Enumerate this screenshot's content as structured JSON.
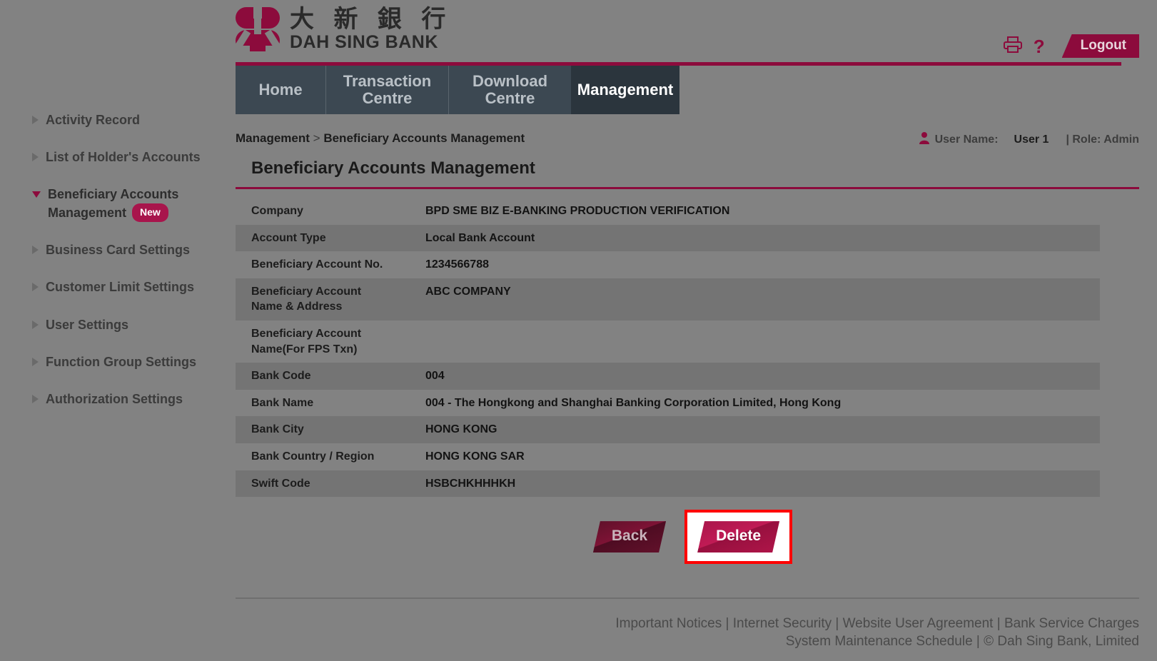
{
  "brand": {
    "name_cn": "大 新 銀 行",
    "name_en": "DAH SING BANK",
    "logo_icon": "dah-sing-logo-icon"
  },
  "header": {
    "print_icon": "print-icon",
    "help_icon": "help-question-icon",
    "logout_label": "Logout"
  },
  "nav": {
    "tabs": [
      {
        "label": "Home",
        "active": false
      },
      {
        "label": "Transaction\nCentre",
        "line1": "Transaction",
        "line2": "Centre",
        "active": false
      },
      {
        "label": "Download\nCentre",
        "line1": "Download",
        "line2": "Centre",
        "active": false
      },
      {
        "label": "Management",
        "line1": "Management",
        "line2": "",
        "active": true
      }
    ]
  },
  "breadcrumb": {
    "root": "Management",
    "separator": ">",
    "current": "Beneficiary Accounts Management"
  },
  "user": {
    "person_icon": "person-icon",
    "label": "User Name:",
    "name": "User 1",
    "role": "| Role: Admin"
  },
  "page": {
    "title": "Beneficiary Accounts Management"
  },
  "details": {
    "rows": [
      {
        "label": "Company",
        "value": "BPD SME BIZ E-BANKING PRODUCTION VERIFICATION",
        "shaded": false
      },
      {
        "label": "Account Type",
        "value": "Local Bank Account",
        "shaded": true
      },
      {
        "label": "Beneficiary Account No.",
        "value": "1234566788",
        "shaded": false
      },
      {
        "label": "Beneficiary Account Name & Address",
        "label_line1": "Beneficiary Account",
        "label_line2": "Name & Address",
        "value": "ABC COMPANY",
        "shaded": true
      },
      {
        "label": "Beneficiary Account Name(For FPS Txn)",
        "label_line1": "Beneficiary Account",
        "label_line2": "Name(For FPS Txn)",
        "value": "",
        "shaded": false
      },
      {
        "label": "Bank Code",
        "value": "004",
        "shaded": true
      },
      {
        "label": "Bank Name",
        "value": "004 - The Hongkong and Shanghai Banking Corporation Limited, Hong Kong",
        "shaded": false
      },
      {
        "label": "Bank City",
        "value": "HONG KONG",
        "shaded": true
      },
      {
        "label": "Bank Country / Region",
        "value": "HONG KONG SAR",
        "shaded": false
      },
      {
        "label": "Swift Code",
        "value": "HSBCHKHHHKH",
        "shaded": true
      }
    ]
  },
  "actions": {
    "back_label": "Back",
    "delete_label": "Delete",
    "highlight_color": "#ff0000"
  },
  "sidebar": {
    "items": [
      {
        "label": "Activity Record",
        "expanded": false,
        "badge": ""
      },
      {
        "label": "List of Holder's Accounts",
        "expanded": false,
        "badge": ""
      },
      {
        "label": "Beneficiary Accounts Management",
        "line1": "Beneficiary Accounts",
        "line2": "Management",
        "expanded": true,
        "badge": "New"
      },
      {
        "label": "Business Card Settings",
        "expanded": false,
        "badge": ""
      },
      {
        "label": "Customer Limit Settings",
        "expanded": false,
        "badge": ""
      },
      {
        "label": "User Settings",
        "expanded": false,
        "badge": ""
      },
      {
        "label": "Function Group Settings",
        "expanded": false,
        "badge": ""
      },
      {
        "label": "Authorization Settings",
        "expanded": false,
        "badge": ""
      }
    ]
  },
  "footer": {
    "line1": [
      {
        "text": "Important Notices",
        "link": true
      },
      {
        "text": " | ",
        "link": false
      },
      {
        "text": "Internet Security",
        "link": true
      },
      {
        "text": " | ",
        "link": false
      },
      {
        "text": "Website User Agreement",
        "link": true
      },
      {
        "text": " | ",
        "link": false
      },
      {
        "text": "Bank Service Charges",
        "link": true
      }
    ],
    "line2": [
      {
        "text": "System Maintenance Schedule",
        "link": true
      },
      {
        "text": " | ",
        "link": false
      },
      {
        "text": "© Dah Sing Bank, Limited",
        "link": false
      }
    ]
  },
  "colors": {
    "brand_red": "#8c0b3c",
    "page_bg": "#828282",
    "row_shade": "#747474",
    "nav_bg": "#3c4852",
    "nav_active": "#2b353d"
  }
}
